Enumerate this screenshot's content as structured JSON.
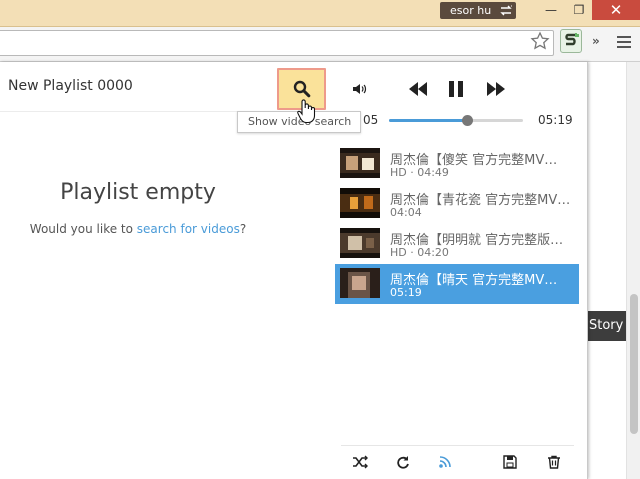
{
  "window": {
    "user_name": "esor hu",
    "minimize": "—",
    "maximize": "❐",
    "close": "✕"
  },
  "browser": {
    "overflow_chevron": "»"
  },
  "page": {
    "side_tab": "Story"
  },
  "player": {
    "playlist_title": "New Playlist 0000",
    "search_tooltip": "Show video search",
    "empty_title": "Playlist empty",
    "empty_prompt": "Would you like to ",
    "empty_link": "search for videos",
    "empty_suffix": "?",
    "time_current": "05",
    "time_total": "05:19",
    "progress_fraction": 0.58,
    "accent_color": "#4a9fe0",
    "highlight_color": "#fae29a",
    "queue": [
      {
        "title": "周杰倫【傻笑 官方完整MV…",
        "meta": "HD · 04:49",
        "active": false
      },
      {
        "title": "周杰倫【青花瓷 官方完整MV…",
        "meta": "04:04",
        "active": false
      },
      {
        "title": "周杰倫【明明就 官方完整版…",
        "meta": "HD · 04:20",
        "active": false
      },
      {
        "title": "周杰倫【晴天 官方完整MV…",
        "meta": "05:19",
        "active": true
      }
    ],
    "icons": [
      "search-icon",
      "volume-icon",
      "previous-icon",
      "pause-icon",
      "next-icon",
      "shuffle-icon",
      "repeat-icon",
      "rss-icon",
      "save-icon",
      "trash-icon"
    ]
  }
}
